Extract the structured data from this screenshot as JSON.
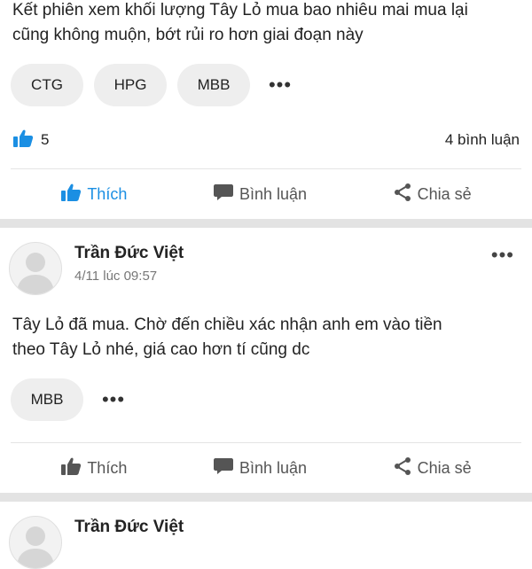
{
  "posts": [
    {
      "content_line1": "Kết phiên xem khối lượng Tây Lỏ mua bao nhiêu mai mua lại",
      "content_line2": "cũng không muộn, bớt rủi ro hơn giai đoạn này",
      "tags": [
        "CTG",
        "HPG",
        "MBB"
      ],
      "more_label": "•••",
      "like_count": "5",
      "comment_count": "4 bình luận",
      "actions": {
        "like": "Thích",
        "comment": "Bình luận",
        "share": "Chia sẻ"
      },
      "like_active": true
    },
    {
      "author": "Trần Đức Việt",
      "timestamp": "4/11 lúc 09:57",
      "content_line1": "Tây Lỏ đã mua. Chờ đến chiều xác nhận anh em vào tiền",
      "content_line2": "theo Tây Lỏ nhé, giá cao hơn tí cũng dc",
      "tags": [
        "MBB"
      ],
      "more_label": "•••",
      "actions": {
        "like": "Thích",
        "comment": "Bình luận",
        "share": "Chia sẻ"
      },
      "like_active": false
    },
    {
      "author": "Trần Đức Việt"
    }
  ],
  "icons": {
    "like": "thumbs-up-icon",
    "comment": "speech-bubble-icon",
    "share": "share-icon",
    "avatar": "default-user-avatar-icon"
  },
  "colors": {
    "accent": "#1b8fe3",
    "chip_bg": "#eeeeee",
    "separator": "#e3e3e3"
  }
}
